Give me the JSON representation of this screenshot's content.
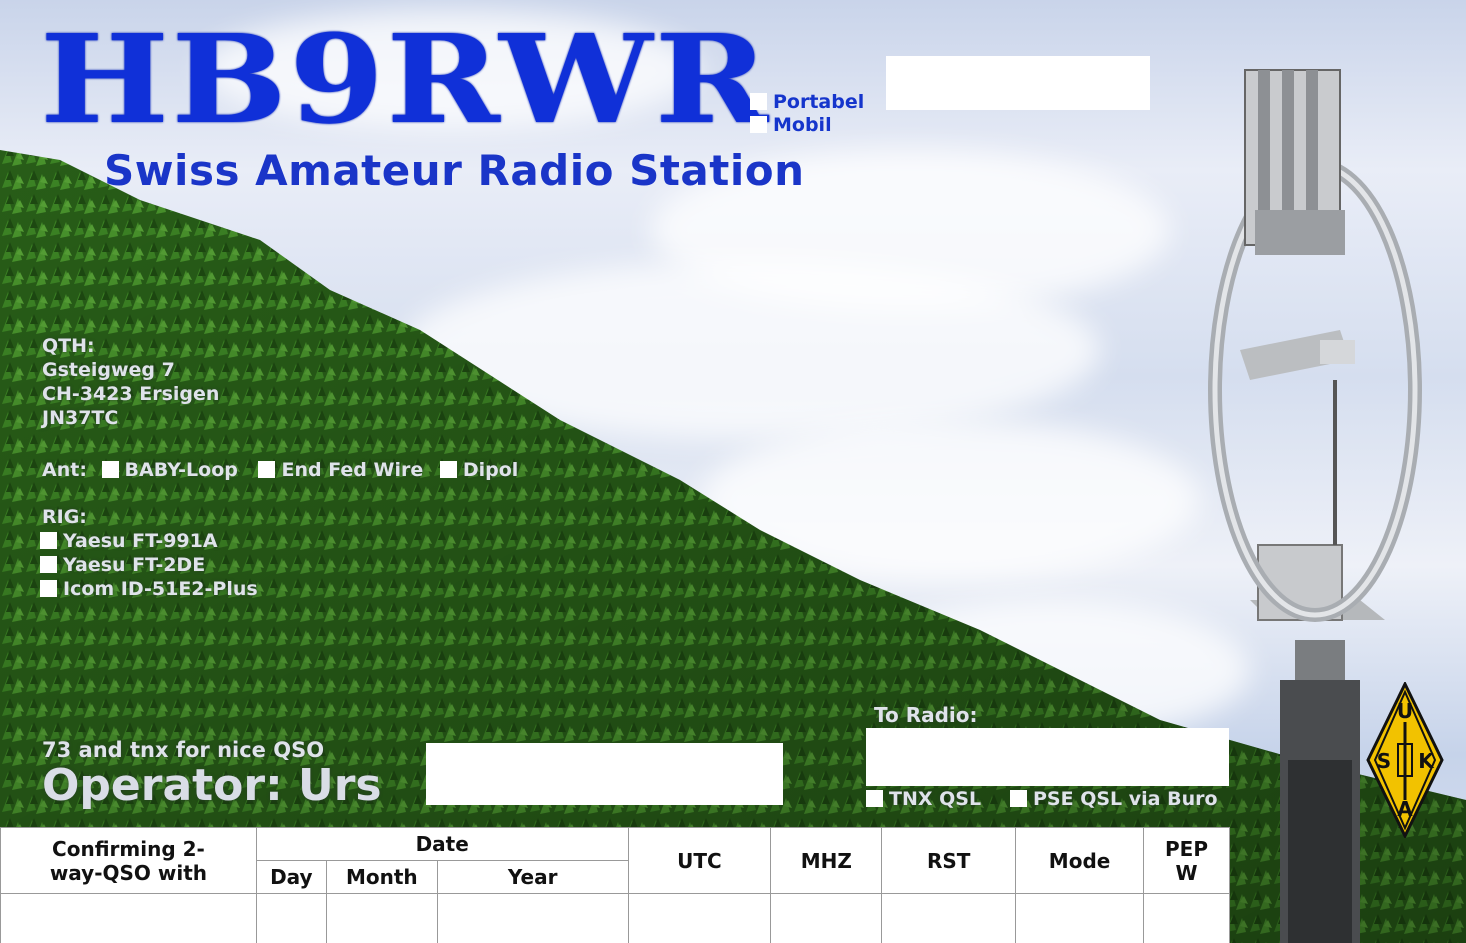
{
  "header": {
    "callsign": "HB9RWR",
    "subtitle": "Swiss Amateur Radio Station",
    "options": [
      "Portabel",
      "Mobil"
    ]
  },
  "qth": {
    "label": "QTH:",
    "lines": [
      "Gsteigweg 7",
      "CH-3423 Ersigen",
      "JN37TC"
    ]
  },
  "antenna": {
    "label": "Ant:",
    "options": [
      "BABY-Loop",
      "End Fed Wire",
      "Dipol"
    ]
  },
  "rig": {
    "label": "RIG:",
    "options": [
      "Yaesu FT-991A",
      "Yaesu FT-2DE",
      "Icom ID-51E2-Plus"
    ]
  },
  "footer": {
    "thanks": "73 and tnx for nice QSO",
    "operator": "Operator: Urs",
    "to_radio": "To Radio:",
    "qsl_options": [
      "TNX QSL",
      "PSE QSL via Buro"
    ]
  },
  "table": {
    "confirm": "Confirming 2-way-QSO with",
    "date": "Date",
    "day": "Day",
    "month": "Month",
    "year": "Year",
    "utc": "UTC",
    "mhz": "MHZ",
    "rst": "RST",
    "mode": "Mode",
    "pep": "PEP",
    "pep_unit": "W"
  },
  "logo": {
    "letters": [
      "U",
      "S",
      "K",
      "A"
    ]
  },
  "colors": {
    "callsign": "#1030d8",
    "hedge": "#2f6b1e",
    "logo": "#f2c200"
  }
}
